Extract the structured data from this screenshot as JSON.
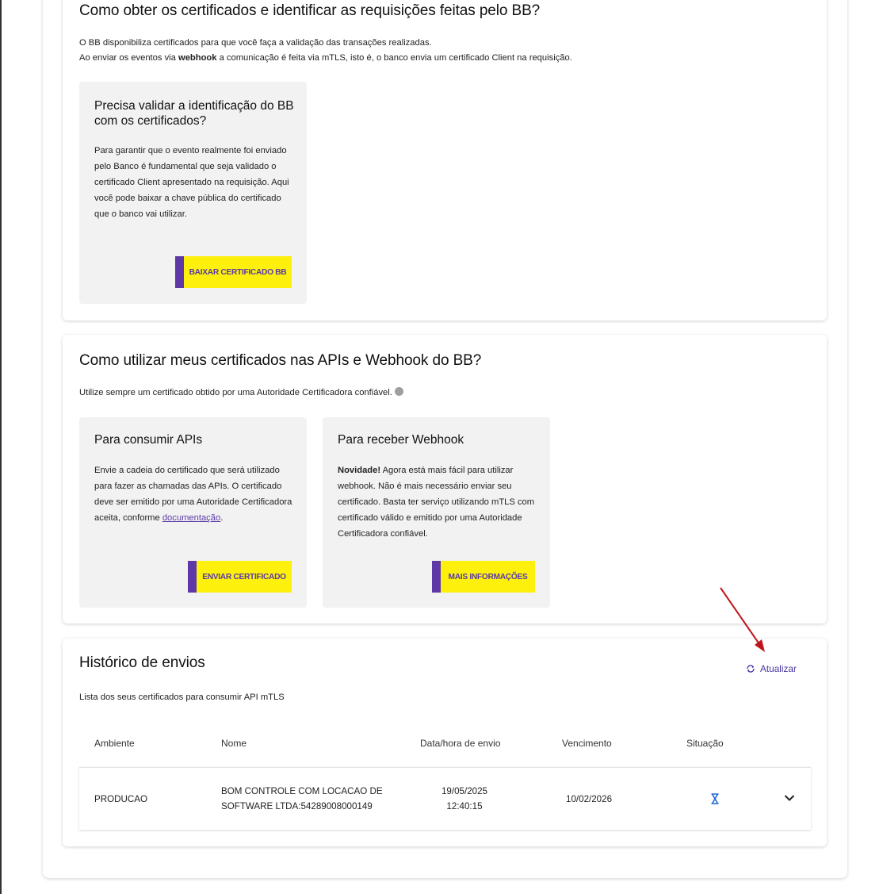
{
  "section_certs": {
    "title": "Como obter os certificados e identificar as requisições feitas pelo BB?",
    "line1": "O BB disponibiliza certificados para que você faça a validação das transações realizadas.",
    "line2_pre": "Ao enviar os eventos via ",
    "line2_bold": "webhook",
    "line2_post": " a comunicação é feita via mTLS, isto é, o banco envia um certificado Client na requisição.",
    "box": {
      "title": "Precisa validar a identificação do BB com os certificados?",
      "text": "Para garantir que o evento realmente foi enviado pelo Banco é fundamental que seja validado o certificado Client apresentado na requisição. Aqui você pode baixar a chave pública do certificado que o banco vai utilizar.",
      "button": "BAIXAR CERTIFICADO BB"
    }
  },
  "section_usage": {
    "title": "Como utilizar meus certificados nas APIs e Webhook do BB?",
    "subtitle": "Utilize sempre um certificado obtido por uma Autoridade Certificadora confiável.",
    "apis_box": {
      "title": "Para consumir APIs",
      "text": "Envie a cadeia do certificado que será utilizado para fazer as chamadas das APIs. O certificado deve ser emitido por uma Autoridade Certificadora aceita, conforme ",
      "link": "documentação",
      "text_end": ".",
      "button": "ENVIAR CERTIFICADO"
    },
    "webhook_box": {
      "title": "Para receber Webhook",
      "bold": "Novidade!",
      "text": " Agora está mais fácil para utilizar webhook. Não é mais necessário enviar seu certificado. Basta ter serviço utilizando mTLS com certificado válido e emitido por uma Autoridade Certificadora confiável.",
      "button": "MAIS INFORMAÇÕES"
    }
  },
  "history": {
    "title": "Histórico de envios",
    "subtitle": "Lista dos seus certificados para consumir API mTLS",
    "refresh_label": "Atualizar",
    "columns": [
      "Ambiente",
      "Nome",
      "Data/hora de envio",
      "Vencimento",
      "Situação"
    ],
    "rows": [
      {
        "ambiente": "PRODUCAO",
        "nome_l1": "BOM CONTROLE COM LOCACAO DE",
        "nome_l2": "SOFTWARE LTDA:54289008000149",
        "data": "19/05/2025",
        "hora": "12:40:15",
        "vencimento": "10/02/2026"
      }
    ]
  },
  "colors": {
    "button_yellow": "#fcf00c",
    "accent_purple": "#5f38a8",
    "annotation_red": "#c0141b"
  }
}
